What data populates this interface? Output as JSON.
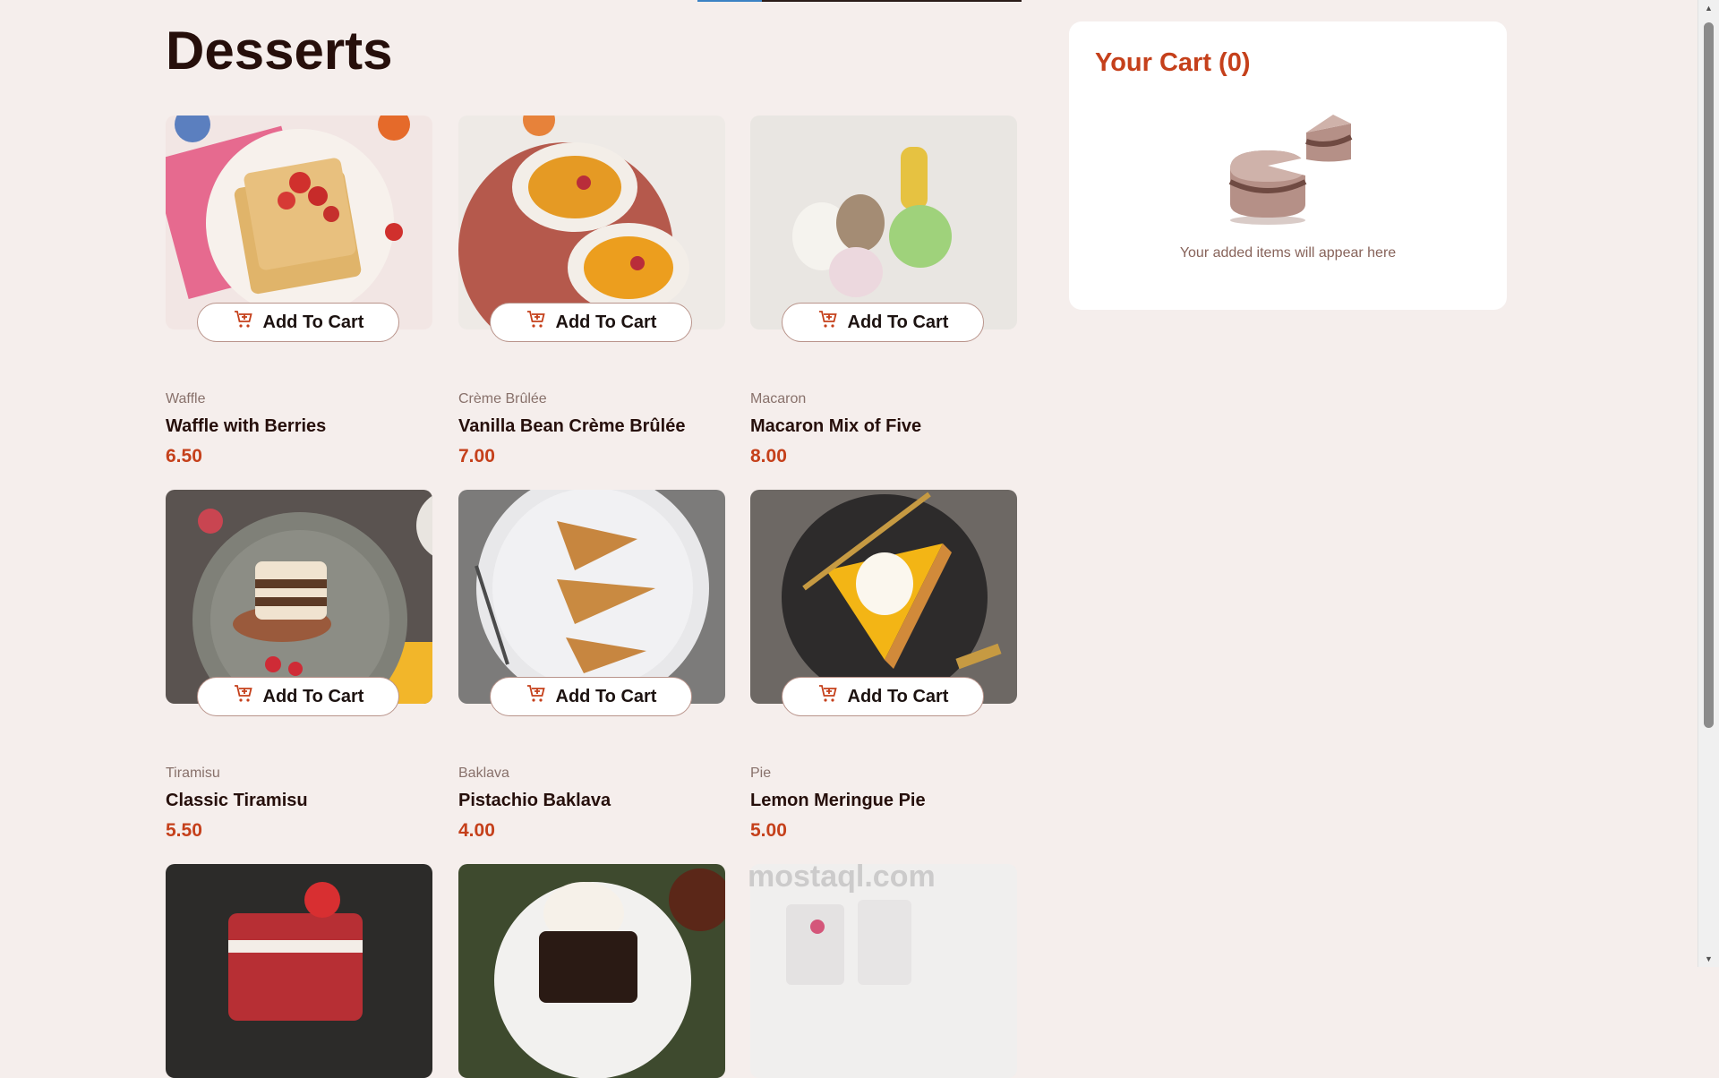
{
  "page_title": "Desserts",
  "button_label": "Add To Cart",
  "products": [
    {
      "category": "Waffle",
      "name": "Waffle with Berries",
      "price": "6.50"
    },
    {
      "category": "Crème Brûlée",
      "name": "Vanilla Bean Crème Brûlée",
      "price": "7.00"
    },
    {
      "category": "Macaron",
      "name": "Macaron Mix of Five",
      "price": "8.00"
    },
    {
      "category": "Tiramisu",
      "name": "Classic Tiramisu",
      "price": "5.50"
    },
    {
      "category": "Baklava",
      "name": "Pistachio Baklava",
      "price": "4.00"
    },
    {
      "category": "Pie",
      "name": "Lemon Meringue Pie",
      "price": "5.00"
    }
  ],
  "cart": {
    "title": "Your Cart (0)",
    "empty_message": "Your added items will appear here",
    "icon": "empty-cart-cake-illustration"
  },
  "watermark": "mostaql.com",
  "colors": {
    "accent": "#c5401b",
    "background": "#f5eeec",
    "text_dark": "#260f0b",
    "text_muted": "#88716b",
    "button_border": "#b9948b"
  },
  "icons": [
    "add-to-cart-icon",
    "empty-cart-cake-illustration"
  ]
}
